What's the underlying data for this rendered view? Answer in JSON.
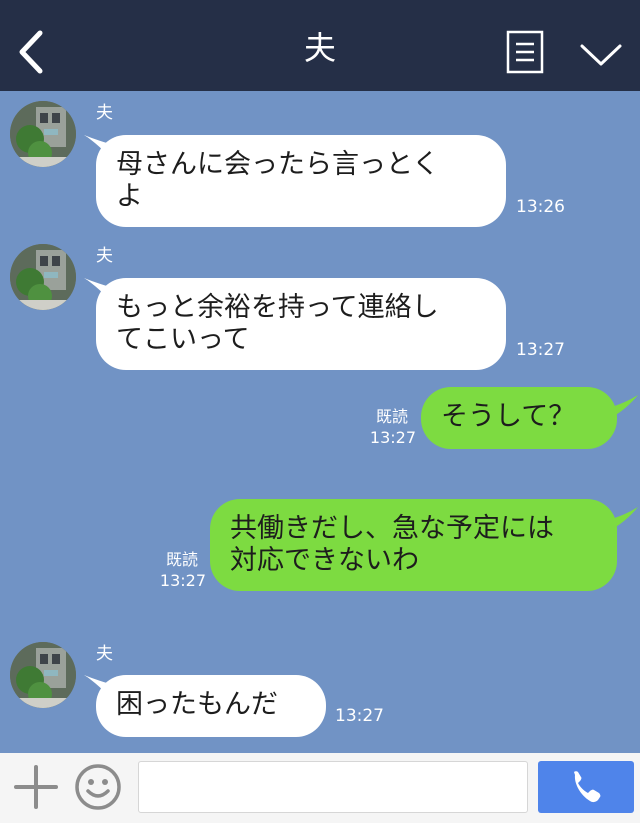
{
  "header": {
    "title": "夫"
  },
  "messages": [
    {
      "sender": "夫",
      "text_line1": "母さんに会ったら言っとく",
      "text_line2": "よ",
      "time": "13:26"
    },
    {
      "sender": "夫",
      "text_line1": "もっと余裕を持って連絡し",
      "text_line2": "てこいって",
      "time": "13:27"
    },
    {
      "read": "既読",
      "time": "13:27",
      "text": "そうして？"
    },
    {
      "read": "既読",
      "time": "13:27",
      "text_line1": "共働きだし、急な予定には",
      "text_line2": "対応できないわ"
    },
    {
      "sender": "夫",
      "text": "困ったもんだ",
      "time": "13:27"
    }
  ],
  "footer": {
    "input_value": ""
  },
  "colors": {
    "header_bg": "#252f47",
    "chat_bg": "#7193c5",
    "incoming_bubble": "#ffffff",
    "outgoing_bubble": "#7ddb41",
    "call_button": "#4f84ea"
  },
  "icons": [
    "back-icon",
    "menu-icon",
    "chevron-down-icon",
    "plus-icon",
    "emoji-icon",
    "phone-icon"
  ]
}
